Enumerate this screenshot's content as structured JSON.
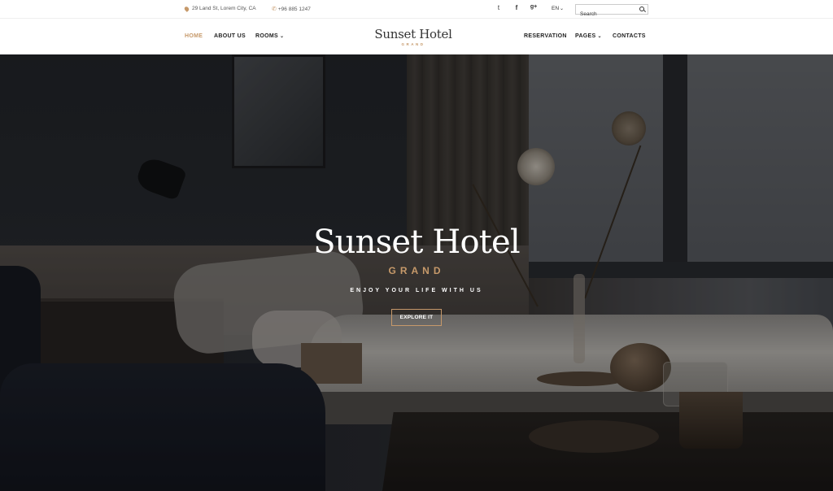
{
  "topbar": {
    "address": "29 Land St, Lorem City, CA",
    "phone": "+96 885 1247",
    "social": {
      "twitter": "t",
      "facebook": "f",
      "googleplus": "g+"
    },
    "language": "EN",
    "search_placeholder": "Search"
  },
  "nav": {
    "home": "HOME",
    "about": "ABOUT US",
    "rooms": "ROOMS",
    "reservation": "RESERVATION",
    "pages": "PAGES",
    "contacts": "CONTACTS"
  },
  "logo": {
    "name": "Sunset Hotel",
    "sub": "GRAND"
  },
  "hero": {
    "title": "Sunset Hotel",
    "subtitle": "GRAND",
    "tagline": "ENJOY YOUR LIFE WITH US",
    "button": "EXPLORE IT"
  },
  "colors": {
    "accent": "#c6996a",
    "text": "#222222"
  },
  "icons": [
    "location-pin-icon",
    "phone-icon",
    "twitter-icon",
    "facebook-icon",
    "google-plus-icon",
    "search-icon",
    "chevron-down-icon"
  ]
}
